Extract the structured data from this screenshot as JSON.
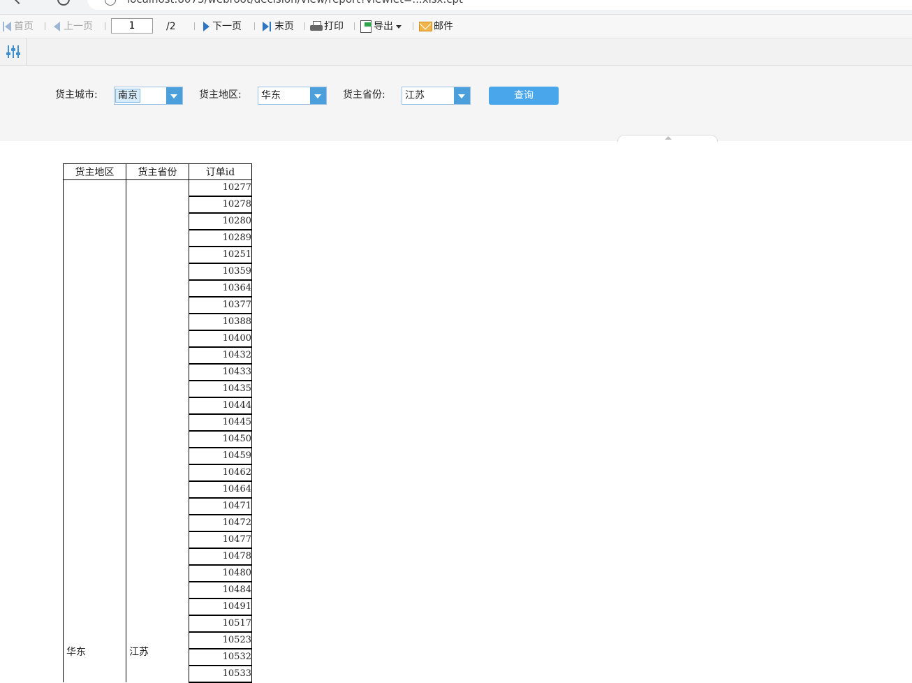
{
  "browser": {
    "url": "localhost:8075/webroot/decision/view/report?viewlet=...xlsx.cpt"
  },
  "toolbar": {
    "first_label": "首页",
    "prev_label": "上一页",
    "current_page": "1",
    "total_pages": "/2",
    "next_label": "下一页",
    "last_label": "末页",
    "print_label": "打印",
    "export_label": "导出",
    "mail_label": "邮件"
  },
  "params": {
    "city_label": "货主城市:",
    "city_value": "南京",
    "region_label": "货主地区:",
    "region_value": "华东",
    "province_label": "货主省份:",
    "province_value": "江苏",
    "query_label": "查询"
  },
  "colors": {
    "accent": "#4aa6ea",
    "combo_button": "#4ba0dc",
    "nav_active": "#2f76c2",
    "nav_disabled": "#9cb6d3"
  },
  "table": {
    "headers": [
      "货主地区",
      "货主省份",
      "订单id"
    ],
    "region": "华东",
    "province": "江苏",
    "order_ids": [
      "10277",
      "10278",
      "10280",
      "10289",
      "10251",
      "10359",
      "10364",
      "10377",
      "10388",
      "10400",
      "10432",
      "10433",
      "10435",
      "10444",
      "10445",
      "10450",
      "10459",
      "10462",
      "10464",
      "10471",
      "10472",
      "10477",
      "10478",
      "10480",
      "10484",
      "10491",
      "10517",
      "10523",
      "10532",
      "10533"
    ]
  }
}
